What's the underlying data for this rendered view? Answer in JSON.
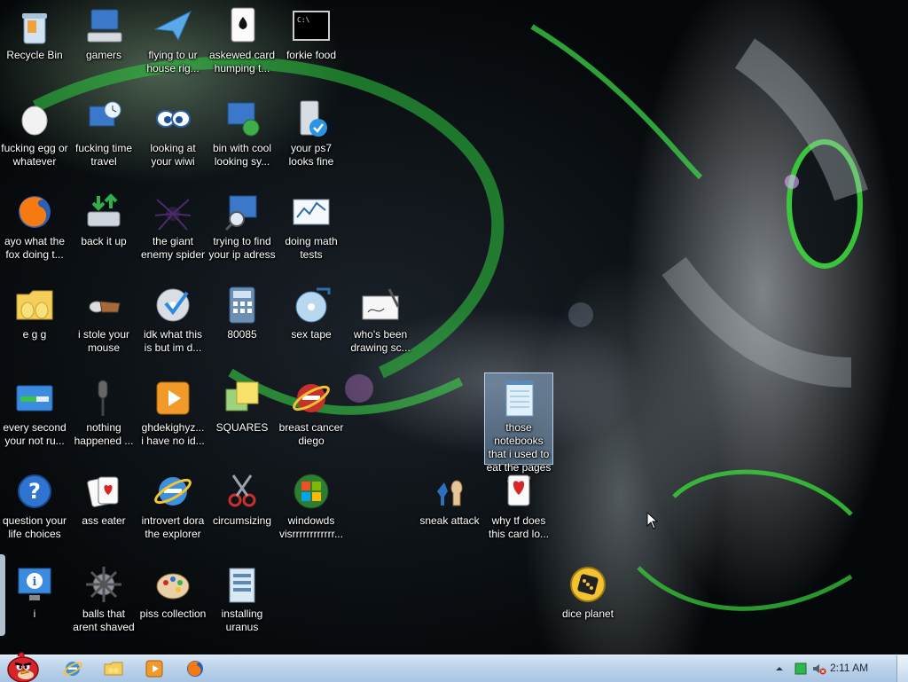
{
  "desktop": {
    "icons": [
      {
        "label": "Recycle Bin",
        "icon": "recycle-bin-icon"
      },
      {
        "label": "gamers",
        "icon": "computer-keyboard-icon"
      },
      {
        "label": "flying to ur house rig...",
        "icon": "paper-plane-icon"
      },
      {
        "label": "askewed card humping t...",
        "icon": "playing-card-icon"
      },
      {
        "label": "forkie food",
        "icon": "command-prompt-icon"
      },
      {
        "label": "fucking egg or whatever",
        "icon": "egg-icon"
      },
      {
        "label": "fucking time travel",
        "icon": "clock-computer-icon"
      },
      {
        "label": "looking at your wiwi",
        "icon": "eyes-icon"
      },
      {
        "label": "bin with cool looking sy...",
        "icon": "network-computer-icon"
      },
      {
        "label": "your ps7 looks fine",
        "icon": "drive-check-icon"
      },
      {
        "label": "ayo what the fox doing t...",
        "icon": "firefox-icon"
      },
      {
        "label": "back it up",
        "icon": "backup-drive-icon"
      },
      {
        "label": "the giant enemy spider",
        "icon": "spider-icon"
      },
      {
        "label": "trying to find your ip adress",
        "icon": "search-computer-icon"
      },
      {
        "label": "doing math tests",
        "icon": "math-chart-icon"
      },
      {
        "label": "e g g",
        "icon": "folder-eggs-icon"
      },
      {
        "label": "i stole your mouse",
        "icon": "hand-mouse-icon"
      },
      {
        "label": "idk what this is but im d...",
        "icon": "disc-check-icon"
      },
      {
        "label": "80085",
        "icon": "calculator-icon"
      },
      {
        "label": "sex tape",
        "icon": "media-disc-icon"
      },
      {
        "label": "who's been drawing sc...",
        "icon": "drawing-pad-icon"
      },
      {
        "label": "every second your not ru...",
        "icon": "window-progress-icon"
      },
      {
        "label": "nothing happened ...",
        "icon": "microphone-icon"
      },
      {
        "label": "ghdekighyz... i have no id...",
        "icon": "media-player-icon"
      },
      {
        "label": "SQUARES",
        "icon": "sticky-notes-icon"
      },
      {
        "label": "breast cancer diego",
        "icon": "internet-explorer-red-icon"
      },
      {
        "label": "those notebooks that i used to eat the pages off of",
        "icon": "notepad-icon"
      },
      {
        "label": "question your life choices",
        "icon": "help-question-icon"
      },
      {
        "label": "ass eater",
        "icon": "cards-icon"
      },
      {
        "label": "introvert dora the explorer",
        "icon": "internet-explorer-icon"
      },
      {
        "label": "circumsizing",
        "icon": "scissors-icon"
      },
      {
        "label": "windowds visrrrrrrrrrrrr...",
        "icon": "windows-logo-icon"
      },
      {
        "label": "sneak attack",
        "icon": "chess-pieces-icon"
      },
      {
        "label": "why tf does this card lo...",
        "icon": "hearts-card-icon"
      },
      {
        "label": "i",
        "icon": "info-computer-icon"
      },
      {
        "label": "balls that arent shaved",
        "icon": "spiky-ball-icon"
      },
      {
        "label": "piss collection",
        "icon": "paint-palette-icon"
      },
      {
        "label": "installing uranus",
        "icon": "installer-icon"
      },
      {
        "label": "dice planet",
        "icon": "dice-icon"
      }
    ]
  },
  "taskbar": {
    "start": {
      "icon": "angry-bird-start-icon"
    },
    "pinned": [
      {
        "name": "internet-explorer",
        "icon": "internet-explorer-icon"
      },
      {
        "name": "explorer",
        "icon": "folder-icon"
      },
      {
        "name": "media-player",
        "icon": "media-player-icon"
      },
      {
        "name": "firefox",
        "icon": "firefox-icon"
      }
    ],
    "tray": {
      "clock": "2:11 AM",
      "icons": [
        "chevron-up-icon",
        "network-icon",
        "volume-muted-icon"
      ]
    }
  },
  "colors": {
    "selection": "#96bee6",
    "taskbar": "#bcd3ea",
    "accent_green": "#39d43a"
  }
}
